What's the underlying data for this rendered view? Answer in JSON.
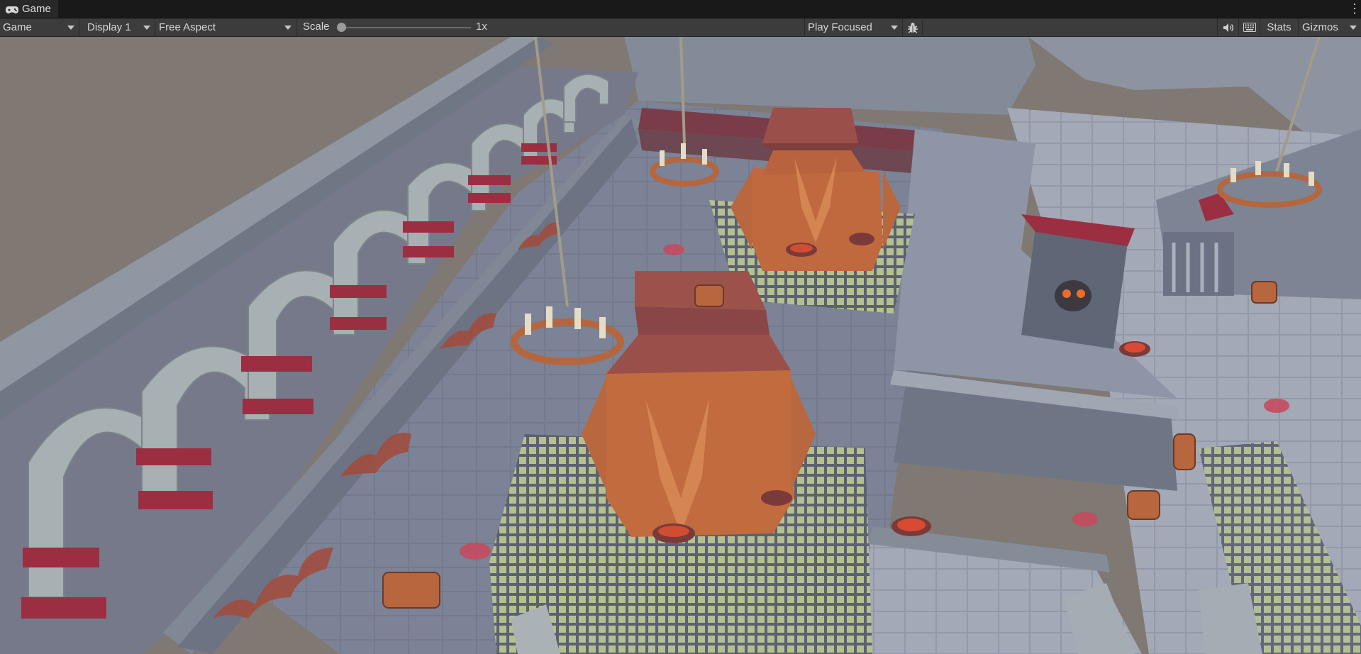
{
  "window": {
    "tab_title": "Game",
    "tab_icon": "gamepad-icon",
    "menu_icon": "kebab-icon"
  },
  "toolbar": {
    "view_mode": "Game",
    "display": "Display 1",
    "aspect": "Free Aspect",
    "scale_label": "Scale",
    "scale_value": "1x",
    "scale_level": 1,
    "play_mode": "Play Focused",
    "bug_icon": "bug-icon",
    "audio_icon": "speaker-icon",
    "grid_icon": "keyboard-grid-icon",
    "stats_label": "Stats",
    "gizmos_label": "Gizmos"
  },
  "scene": {
    "description_icon": "dungeon-render",
    "colors": {
      "backdrop": "#7f7873",
      "stone": "#8a93a3",
      "floor": "#6f7689",
      "accent_red": "#9c2e42",
      "wood": "#b8663e",
      "grate_light": "#a8b888"
    }
  }
}
